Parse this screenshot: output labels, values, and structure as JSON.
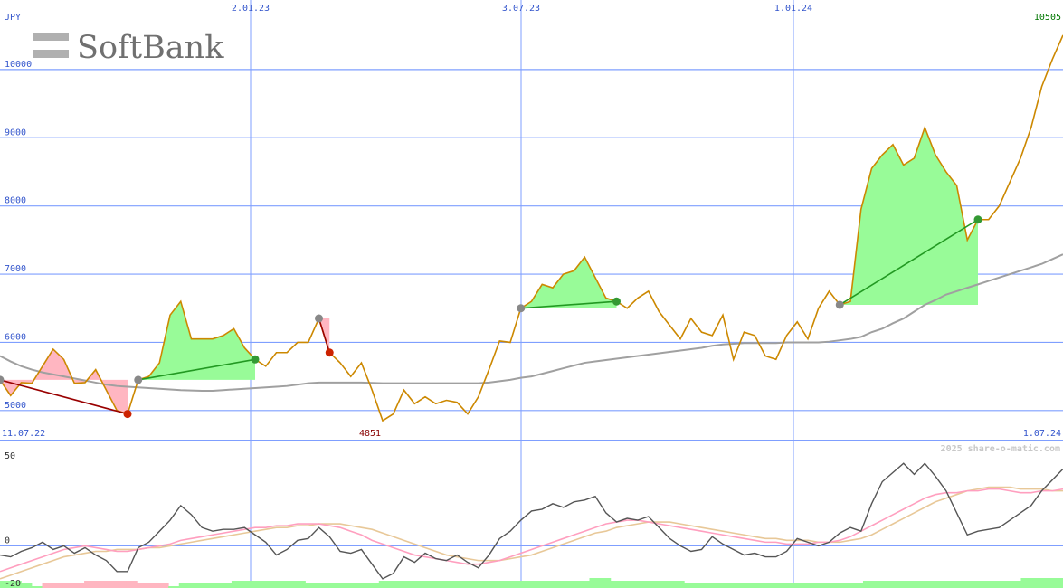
{
  "logo": {
    "text": "SoftBank"
  },
  "chart_data": {
    "type": "line",
    "currency": "JPY",
    "last_value": "10505",
    "min_label": "4851",
    "x_start_label": "11.07.22",
    "x_end_label": "1.07.24",
    "watermark": "2025 share-o-matic.com",
    "top_date_labels": [
      "2.01.23",
      "3.07.23",
      "1.01.24"
    ],
    "y_ticks": [
      "5000",
      "6000",
      "7000",
      "8000",
      "9000",
      "10000"
    ],
    "ylim": [
      4560,
      11020
    ],
    "price": {
      "color": "#cc8800",
      "values": [
        5450,
        5220,
        5410,
        5400,
        5650,
        5900,
        5750,
        5400,
        5410,
        5600,
        5300,
        5000,
        4950,
        5450,
        5500,
        5700,
        6400,
        6600,
        6050,
        6050,
        6050,
        6100,
        6200,
        5920,
        5750,
        5650,
        5850,
        5850,
        6000,
        6000,
        6350,
        5850,
        5700,
        5500,
        5700,
        5300,
        4851,
        4950,
        5300,
        5100,
        5200,
        5100,
        5150,
        5120,
        4950,
        5200,
        5600,
        6020,
        6000,
        6500,
        6600,
        6850,
        6800,
        7000,
        7050,
        7250,
        6950,
        6650,
        6600,
        6500,
        6650,
        6750,
        6450,
        6250,
        6050,
        6350,
        6150,
        6100,
        6400,
        5750,
        6150,
        6100,
        5800,
        5750,
        6100,
        6300,
        6050,
        6500,
        6750,
        6550,
        6600,
        7950,
        8550,
        8750,
        8900,
        8600,
        8700,
        9150,
        8750,
        8500,
        8300,
        7500,
        7800,
        7800,
        8000,
        8350,
        8700,
        9150,
        9750,
        10150,
        10505
      ]
    },
    "moving_average": {
      "color": "#a0a0a0",
      "values": [
        5800,
        5720,
        5650,
        5600,
        5560,
        5530,
        5500,
        5470,
        5440,
        5410,
        5380,
        5360,
        5350,
        5340,
        5330,
        5320,
        5310,
        5300,
        5295,
        5290,
        5290,
        5300,
        5310,
        5320,
        5330,
        5340,
        5350,
        5360,
        5380,
        5400,
        5410,
        5410,
        5410,
        5410,
        5410,
        5405,
        5400,
        5400,
        5400,
        5400,
        5400,
        5400,
        5400,
        5400,
        5400,
        5400,
        5410,
        5430,
        5450,
        5480,
        5500,
        5540,
        5580,
        5620,
        5660,
        5700,
        5720,
        5740,
        5760,
        5780,
        5800,
        5820,
        5840,
        5860,
        5880,
        5900,
        5920,
        5950,
        5970,
        5980,
        5990,
        5990,
        5990,
        5990,
        6000,
        6000,
        6000,
        6000,
        6010,
        6030,
        6050,
        6080,
        6150,
        6200,
        6280,
        6350,
        6450,
        6550,
        6620,
        6700,
        6750,
        6800,
        6850,
        6900,
        6950,
        7000,
        7050,
        7100,
        7150,
        7220,
        7290
      ]
    },
    "trades": [
      {
        "entry": 0,
        "exit": 12,
        "result": "loss"
      },
      {
        "entry": 13,
        "exit": 24,
        "result": "gain"
      },
      {
        "entry": 30,
        "exit": 31,
        "result": "loss"
      },
      {
        "entry": 49,
        "exit": 58,
        "result": "gain"
      },
      {
        "entry": 79,
        "exit": 92,
        "result": "gain"
      }
    ],
    "colors": {
      "gain_fill": "#98fb98",
      "loss_fill": "#ffb6c1",
      "gain_line": "#229922",
      "loss_line": "#990000",
      "grid": "#7f9fff",
      "axis_text": "#3355cc",
      "min_text": "#880000",
      "last_text": "#007700"
    },
    "oscillator": {
      "y_ticks": [
        "50",
        "0",
        "-20"
      ],
      "ylim": [
        -22,
        54
      ],
      "momentum": {
        "color": "#555555",
        "values": [
          -5,
          -6,
          -3,
          -1,
          2,
          -2,
          0,
          -4,
          -1,
          -5,
          -8,
          -14,
          -14,
          -1,
          2,
          8,
          14,
          22,
          17,
          10,
          8,
          9,
          9,
          10,
          6,
          2,
          -5,
          -2,
          3,
          4,
          10,
          5,
          -3,
          -4,
          -2,
          -10,
          -18,
          -15,
          -6,
          -9,
          -4,
          -7,
          -8,
          -5,
          -9,
          -12,
          -5,
          4,
          8,
          14,
          19,
          20,
          23,
          21,
          24,
          25,
          27,
          18,
          13,
          15,
          14,
          16,
          10,
          4,
          0,
          -3,
          -2,
          5,
          1,
          -2,
          -5,
          -4,
          -6,
          -6,
          -3,
          4,
          2,
          0,
          2,
          7,
          10,
          8,
          23,
          35,
          40,
          45,
          39,
          45,
          38,
          30,
          18,
          6,
          8,
          9,
          10,
          14,
          18,
          22,
          30,
          36,
          42
        ]
      },
      "signal_pink": {
        "color": "#ff9fbf",
        "values": [
          -14,
          -12,
          -10,
          -8,
          -6,
          -4,
          -2,
          -1,
          0,
          -1,
          -2,
          -3,
          -3,
          -2,
          -1,
          0,
          1,
          3,
          4,
          5,
          6,
          7,
          8,
          9,
          10,
          10,
          11,
          11,
          12,
          12,
          12,
          11,
          10,
          8,
          6,
          3,
          1,
          -1,
          -3,
          -5,
          -6,
          -7,
          -8,
          -9,
          -10,
          -10,
          -9,
          -8,
          -6,
          -4,
          -2,
          0,
          2,
          4,
          6,
          8,
          10,
          12,
          13,
          14,
          14,
          13,
          12,
          11,
          10,
          9,
          8,
          7,
          6,
          5,
          4,
          3,
          2,
          2,
          1,
          1,
          1,
          2,
          2,
          3,
          5,
          8,
          11,
          14,
          17,
          20,
          23,
          26,
          28,
          29,
          29,
          30,
          30,
          31,
          31,
          30,
          29,
          29,
          30,
          30,
          31
        ]
      },
      "signal_tan": {
        "color": "#e8c898",
        "values": [
          -18,
          -16,
          -14,
          -12,
          -10,
          -8,
          -6,
          -5,
          -4,
          -3,
          -3,
          -2,
          -2,
          -2,
          -1,
          -1,
          0,
          1,
          2,
          3,
          4,
          5,
          6,
          7,
          8,
          9,
          10,
          10,
          11,
          11,
          12,
          12,
          12,
          11,
          10,
          9,
          7,
          5,
          3,
          1,
          -1,
          -3,
          -5,
          -6,
          -7,
          -8,
          -8,
          -8,
          -7,
          -6,
          -5,
          -3,
          -1,
          1,
          3,
          5,
          7,
          8,
          10,
          11,
          12,
          13,
          13,
          13,
          12,
          11,
          10,
          9,
          8,
          7,
          6,
          5,
          4,
          4,
          3,
          3,
          3,
          2,
          2,
          2,
          3,
          4,
          6,
          9,
          12,
          15,
          18,
          21,
          24,
          26,
          28,
          30,
          31,
          32,
          32,
          32,
          31,
          31,
          31,
          30,
          30
        ]
      },
      "volume_bars": {
        "color": "#98fb98",
        "neg_color": "#ffb6c1",
        "values": [
          2,
          2,
          1,
          0,
          -1,
          -1,
          -1,
          -1,
          -2,
          -2,
          -2,
          -2,
          -2,
          -1,
          -1,
          -1,
          0,
          1,
          1,
          1,
          1,
          1,
          2,
          2,
          2,
          2,
          2,
          2,
          2,
          1,
          1,
          1,
          1,
          1,
          1,
          1,
          2,
          2,
          2,
          2,
          2,
          2,
          2,
          2,
          2,
          2,
          2,
          2,
          2,
          2,
          2,
          2,
          2,
          2,
          2,
          2,
          3,
          3,
          2,
          2,
          2,
          2,
          2,
          2,
          2,
          1,
          1,
          1,
          1,
          1,
          1,
          1,
          1,
          1,
          1,
          1,
          1,
          1,
          1,
          1,
          1,
          1,
          2,
          2,
          2,
          2,
          2,
          2,
          2,
          2,
          2,
          2,
          2,
          2,
          2,
          2,
          2,
          3,
          3,
          3,
          3
        ]
      }
    }
  }
}
